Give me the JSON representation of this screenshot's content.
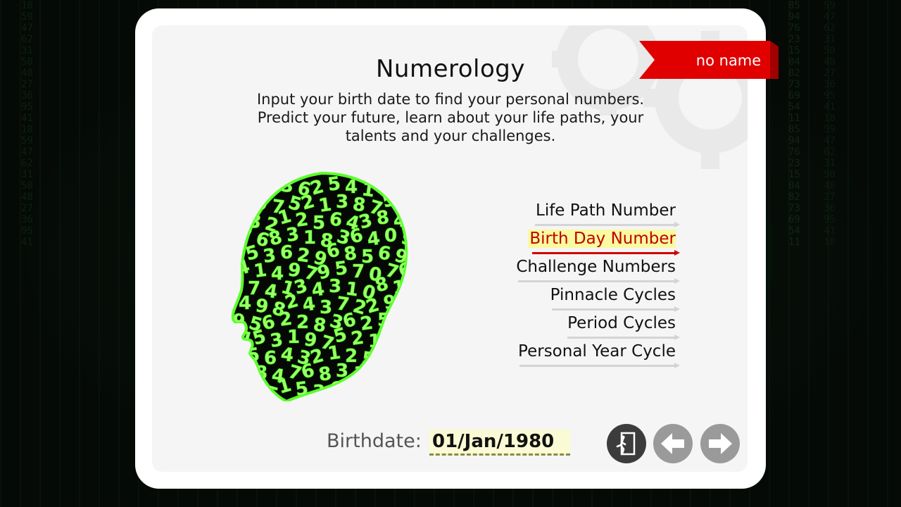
{
  "app": {
    "title": "Numerology",
    "description_lines": [
      "Input your birth date to find your personal numbers.",
      "Predict your future, learn about your life paths, your",
      "talents and your challenges."
    ],
    "user_ribbon": "no name"
  },
  "menu": {
    "items": [
      {
        "label": "Life Path Number",
        "active": false
      },
      {
        "label": "Birth Day Number",
        "active": true
      },
      {
        "label": "Challenge Numbers",
        "active": false
      },
      {
        "label": "Pinnacle Cycles",
        "active": false
      },
      {
        "label": "Period Cycles",
        "active": false
      },
      {
        "label": "Personal Year Cycle",
        "active": false
      }
    ]
  },
  "birthdate": {
    "label": "Birthdate:",
    "value": "01/Jan/1980"
  },
  "buttons": {
    "exit_icon": "exit-door-icon",
    "back_icon": "arrow-left-icon",
    "forward_icon": "arrow-right-icon"
  },
  "head_digits": [
    "2",
    "2",
    "8",
    "3",
    "6",
    "2",
    "5",
    "4",
    "1",
    "5",
    "3",
    "1",
    "9",
    "7",
    "5",
    "2",
    "1",
    "3",
    "8",
    "7",
    "5",
    "6",
    "4",
    "3",
    "2",
    "1",
    "2",
    "5",
    "6",
    "4",
    "3",
    "8",
    "4",
    "7",
    "6",
    "8",
    "3",
    "1",
    "8",
    "3",
    "6",
    "4",
    "0",
    "5",
    "1",
    "5",
    "3",
    "6",
    "2",
    "9",
    "6",
    "8",
    "5",
    "6",
    "9",
    "4",
    "1",
    "4",
    "9",
    "7",
    "9",
    "5",
    "7",
    "0",
    "7",
    "6",
    "0",
    "7",
    "4",
    "1",
    "3",
    "4",
    "3",
    "1",
    "0",
    "8",
    "1",
    "4",
    "9",
    "8",
    "2",
    "4",
    "3",
    "7",
    "2",
    "2",
    "9",
    "0",
    "9",
    "5",
    "6"
  ],
  "colors": {
    "ribbon": "#e00000",
    "active_text": "#c00000",
    "active_highlight": "#fafaa0",
    "head_glow": "#39ff14",
    "button_grey": "#9a9a9a",
    "button_dark": "#3c3c3c"
  }
}
